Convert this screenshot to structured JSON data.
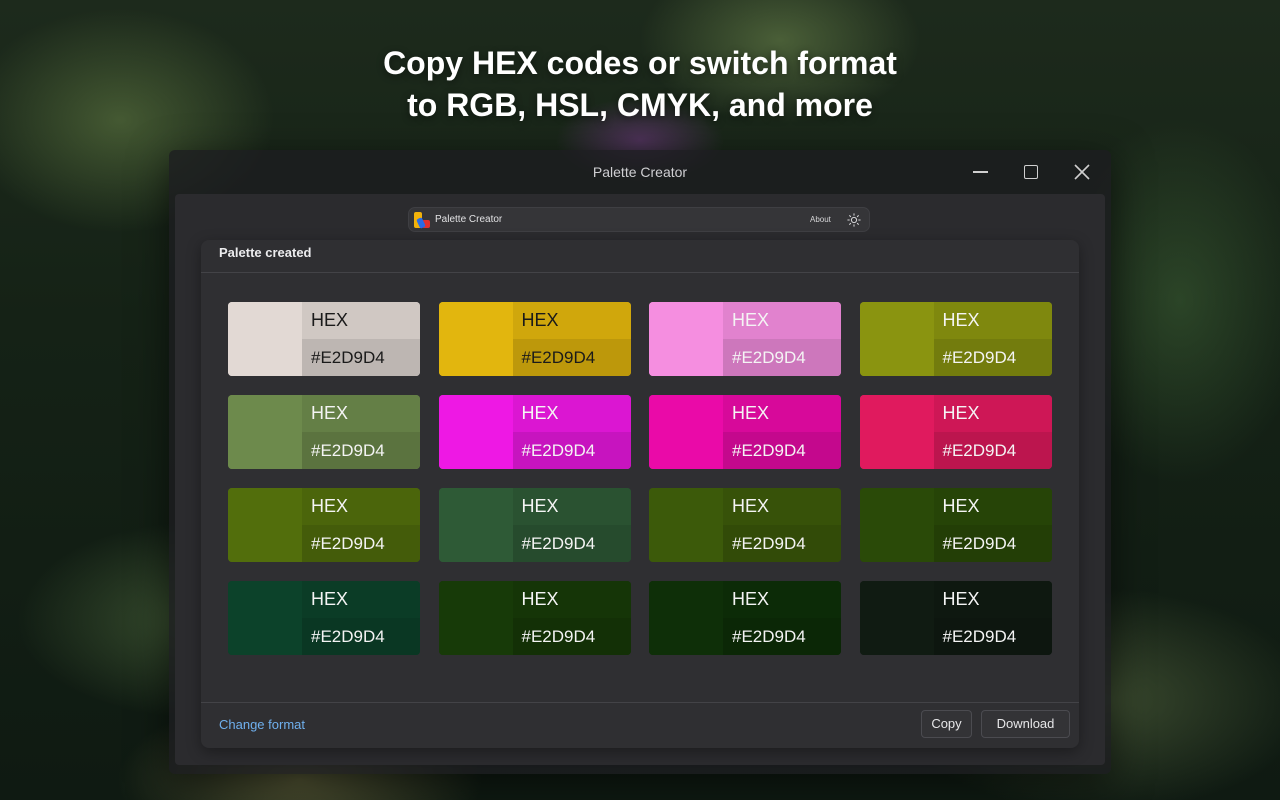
{
  "headline": {
    "line1": "Copy HEX codes or switch format",
    "line2": "to RGB, HSL, CMYK, and more"
  },
  "window": {
    "title": "Palette Creator",
    "controls": [
      "minimize-icon",
      "maximize-icon",
      "close-icon"
    ]
  },
  "navbar": {
    "brand": "Palette Creator",
    "about": "About",
    "theme_icon": "sun-icon"
  },
  "card": {
    "title": "Palette created",
    "change_format": "Change format",
    "copy_label": "Copy",
    "download_label": "Download"
  },
  "swatches": [
    {
      "format": "HEX",
      "value": "#E2D9D4",
      "color": "#e2d9d4",
      "text": "dark"
    },
    {
      "format": "HEX",
      "value": "#E2D9D4",
      "color": "#e2b60e",
      "text": "dark"
    },
    {
      "format": "HEX",
      "value": "#E2D9D4",
      "color": "#f58ee0",
      "text": "light"
    },
    {
      "format": "HEX",
      "value": "#E2D9D4",
      "color": "#8a9410",
      "text": "light"
    },
    {
      "format": "HEX",
      "value": "#E2D9D4",
      "color": "#6d8a4c",
      "text": "light"
    },
    {
      "format": "HEX",
      "value": "#E2D9D4",
      "color": "#ee18e4",
      "text": "light"
    },
    {
      "format": "HEX",
      "value": "#E2D9D4",
      "color": "#ea0aa8",
      "text": "light"
    },
    {
      "format": "HEX",
      "value": "#E2D9D4",
      "color": "#e01a5e",
      "text": "light"
    },
    {
      "format": "HEX",
      "value": "#E2D9D4",
      "color": "#526e0c",
      "text": "light"
    },
    {
      "format": "HEX",
      "value": "#E2D9D4",
      "color": "#2e5a36",
      "text": "light"
    },
    {
      "format": "HEX",
      "value": "#E2D9D4",
      "color": "#3c5a0a",
      "text": "light"
    },
    {
      "format": "HEX",
      "value": "#E2D9D4",
      "color": "#2a4a08",
      "text": "light"
    },
    {
      "format": "HEX",
      "value": "#E2D9D4",
      "color": "#0c422a",
      "text": "light"
    },
    {
      "format": "HEX",
      "value": "#E2D9D4",
      "color": "#173a08",
      "text": "light"
    },
    {
      "format": "HEX",
      "value": "#E2D9D4",
      "color": "#0e2f08",
      "text": "light"
    },
    {
      "format": "HEX",
      "value": "#E2D9D4",
      "color": "#101b12",
      "text": "light"
    }
  ],
  "colors": {
    "accent_link": "#6fb0ee",
    "app_background": "#2b2b2e"
  }
}
